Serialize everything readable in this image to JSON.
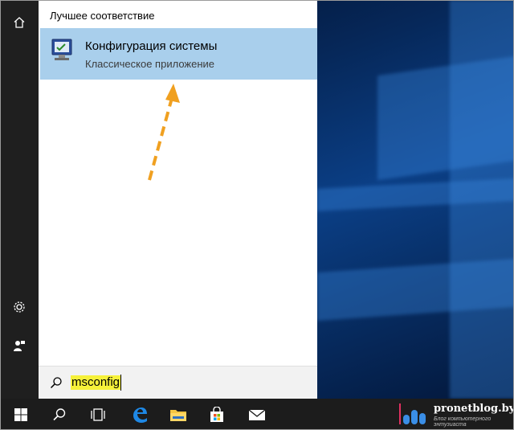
{
  "search_panel": {
    "section_title": "Лучшее соответствие",
    "best_match": {
      "title": "Конфигурация системы",
      "subtitle": "Классическое приложение",
      "icon": "msconfig-app-icon"
    }
  },
  "search_box": {
    "query": "msconfig",
    "icon": "search-icon"
  },
  "left_rail": {
    "items": [
      {
        "icon": "home-icon"
      },
      {
        "icon": "gear-icon"
      },
      {
        "icon": "user-feedback-icon"
      }
    ]
  },
  "taskbar": {
    "items": [
      {
        "icon": "windows-start-icon"
      },
      {
        "icon": "search-icon"
      },
      {
        "icon": "task-view-icon"
      },
      {
        "icon": "edge-browser-icon"
      },
      {
        "icon": "file-explorer-icon"
      },
      {
        "icon": "store-icon"
      },
      {
        "icon": "mail-icon"
      }
    ]
  },
  "watermark": {
    "name": "pronetblog.by",
    "tagline": "Блог компьютерного энтузиаста"
  },
  "colors": {
    "selection": "#a9cfec",
    "highlight": "#f6f13a",
    "arrow": "#f0a020",
    "rail": "#1f1f1f",
    "taskbar": "#1c1c1c"
  }
}
